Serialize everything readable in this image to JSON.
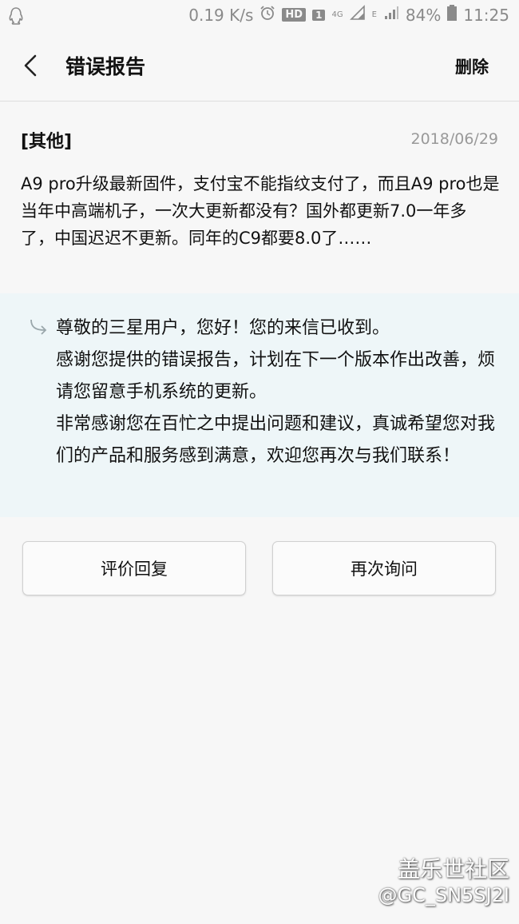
{
  "status_bar": {
    "speed": "0.19 K/s",
    "hd": "HD",
    "sim": "1",
    "net4g": "4G",
    "netE": "E",
    "battery": "84%",
    "time": "11:25"
  },
  "header": {
    "title": "错误报告",
    "delete_label": "删除"
  },
  "report": {
    "category": "[其他]",
    "date": "2018/06/29",
    "body": "A9 pro升级最新固件，支付宝不能指纹支付了，而且A9 pro也是当年中高端机子，一次大更新都没有？国外都更新7.0一年多了，中国迟迟不更新。同年的C9都要8.0了……"
  },
  "reply": {
    "lines": [
      "尊敬的三星用户，您好！您的来信已收到。",
      "感谢您提供的错误报告，计划在下一个版本作出改善，烦请您留意手机系统的更新。",
      "非常感谢您在百忙之中提出问题和建议，真诚希望您对我们的产品和服务感到满意，欢迎您再次与我们联系！"
    ]
  },
  "buttons": {
    "rate_label": "评价回复",
    "ask_label": "再次询问"
  },
  "watermark": {
    "line1": "盖乐世社区",
    "line2": "@GC_SN5SJ2I"
  }
}
